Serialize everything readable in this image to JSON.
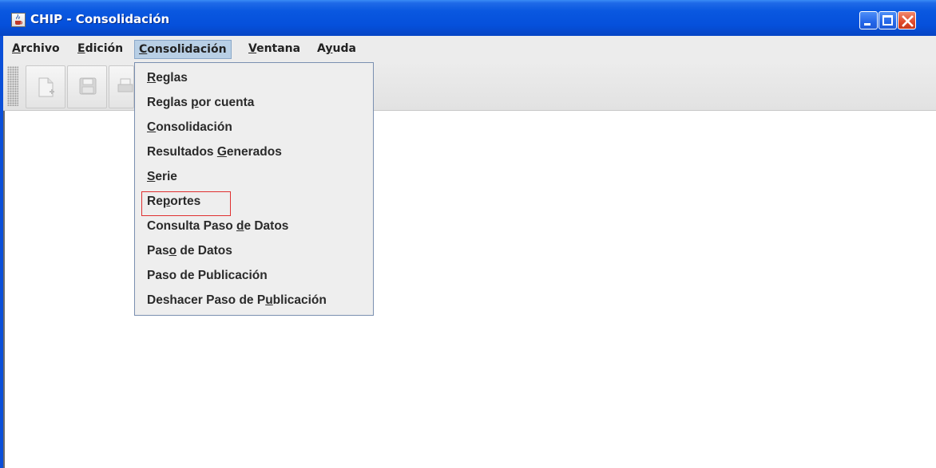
{
  "window": {
    "title": "CHIP - Consolidación",
    "icon": "java-cup-icon",
    "controls": [
      "minimize",
      "maximize",
      "close"
    ]
  },
  "menubar": {
    "items": [
      {
        "label": "Archivo",
        "mnemonic": "A"
      },
      {
        "label": "Edición",
        "mnemonic": "E"
      },
      {
        "label": "Consolidación",
        "mnemonic": "C",
        "active": true
      },
      {
        "label": "Ventana",
        "mnemonic": "V"
      },
      {
        "label": "Ayuda",
        "mnemonic": "y"
      }
    ]
  },
  "toolbar": {
    "buttons": [
      "new-document-icon",
      "save-icon",
      "print-icon"
    ]
  },
  "dropdown": {
    "items": [
      {
        "pre": "",
        "u": "R",
        "post": "eglas"
      },
      {
        "pre": "Reglas ",
        "u": "p",
        "post": "or cuenta"
      },
      {
        "pre": "",
        "u": "C",
        "post": "onsolidación"
      },
      {
        "pre": "Resultados ",
        "u": "G",
        "post": "enerados"
      },
      {
        "pre": "",
        "u": "S",
        "post": "erie"
      },
      {
        "pre": "Re",
        "u": "p",
        "post": "ortes"
      },
      {
        "pre": "Consulta Paso ",
        "u": "d",
        "post": "e Datos"
      },
      {
        "pre": "Pas",
        "u": "o",
        "post": " de Datos"
      },
      {
        "pre": "Paso de Publicación",
        "u": "",
        "post": ""
      },
      {
        "pre": "Deshacer Paso de P",
        "u": "u",
        "post": "blicación"
      }
    ],
    "highlighted_item": "Reportes",
    "highlight_color": "#e03030"
  },
  "colors": {
    "titlebar": "#0a58e0",
    "menu_active": "#b8cfe5",
    "menu_bg": "#eeeeee"
  }
}
